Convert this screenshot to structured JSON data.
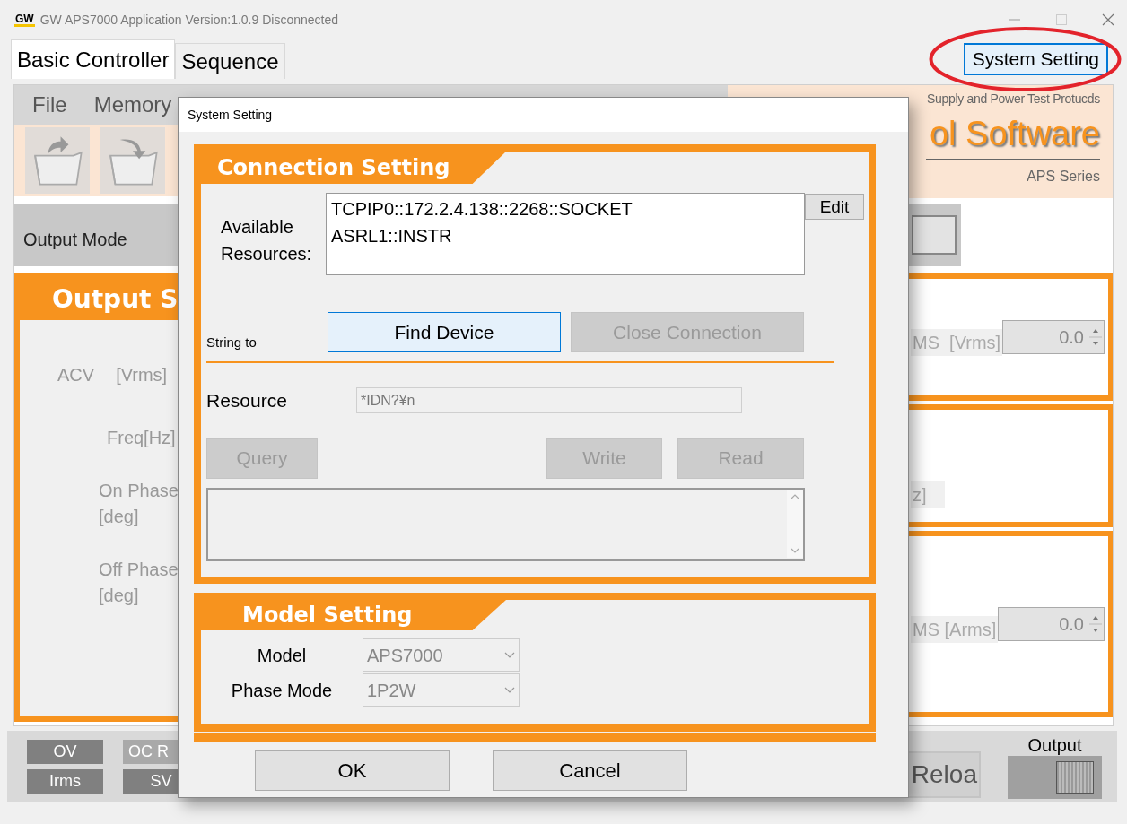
{
  "window": {
    "logo": "GW",
    "title": "GW APS7000 Application Version:1.0.9 Disconnected"
  },
  "tabs": [
    {
      "label": "Basic Controller",
      "selected": true
    },
    {
      "label": "Sequence",
      "selected": false
    }
  ],
  "system_setting_button": {
    "label": "System Setting",
    "circled": true
  },
  "menu": [
    "File",
    "Memory"
  ],
  "banner": {
    "tagline": "Supply and Power Test Protucds",
    "title": "ol Software",
    "series": "APS Series"
  },
  "output_mode": {
    "label": "Output Mode"
  },
  "output_setting": {
    "title": "Output S",
    "fields": [
      {
        "kind": "pair",
        "texts": [
          "ACV",
          "[Vrms]"
        ]
      },
      {
        "kind": "single",
        "texts": [
          "Freq[Hz]"
        ]
      },
      {
        "kind": "stacked",
        "texts": [
          "On Phase",
          "[deg]"
        ]
      },
      {
        "kind": "stacked",
        "texts": [
          "Off Phase",
          "[deg]"
        ]
      }
    ]
  },
  "measure_cards": [
    {
      "label": "MS  [Vrms]",
      "value": "0.0"
    },
    {
      "label": "z]"
    },
    {
      "label": "MS [Arms]",
      "value": "0.0"
    }
  ],
  "status_flags": [
    {
      "label": "OV",
      "active": true
    },
    {
      "label": "Irms",
      "active": true
    },
    {
      "label": "OC R",
      "active": false
    },
    {
      "label": "SV",
      "active": true
    }
  ],
  "reload_button": "Reloa",
  "output_switch": {
    "label": "Output",
    "on": false
  },
  "dialog": {
    "title": "System Setting",
    "connection": {
      "title": "Connection Setting",
      "resources_label": "Available Resources:",
      "resources": [
        "TCPIP0::172.2.4.138::2268::SOCKET",
        "ASRL1::INSTR"
      ],
      "edit_button": "Edit",
      "string_label": "String to",
      "buttons": [
        {
          "label": "Find Device",
          "disabled": false,
          "focused": true
        },
        {
          "label": "Close Connection",
          "disabled": true,
          "focused": false
        }
      ],
      "resource_label": "Resource",
      "resource_value": "*IDN?¥n",
      "resource_disabled": true,
      "io_buttons": [
        {
          "label": "Query",
          "disabled": true
        },
        {
          "label": "Write",
          "disabled": true
        },
        {
          "label": "Read",
          "disabled": true
        }
      ]
    },
    "model": {
      "title": "Model Setting",
      "fields": [
        {
          "label": "Model",
          "value": "APS7000",
          "disabled": true
        },
        {
          "label": "Phase Mode",
          "value": "1P2W",
          "disabled": true
        }
      ]
    },
    "buttons": [
      "OK",
      "Cancel"
    ]
  }
}
